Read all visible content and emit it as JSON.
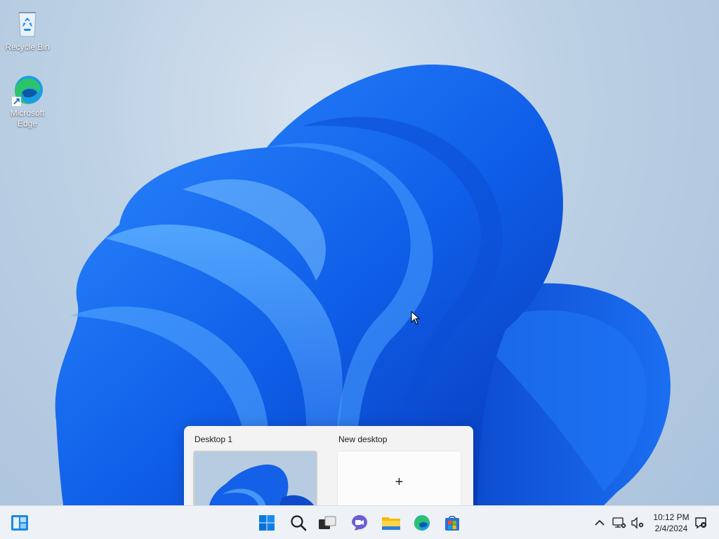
{
  "desktop": {
    "icons": [
      {
        "label": "Recycle Bin",
        "icon": "recycle-bin-icon"
      },
      {
        "label": "Microsoft Edge",
        "icon": "edge-icon"
      }
    ]
  },
  "task_view": {
    "desktops": [
      {
        "label": "Desktop 1"
      },
      {
        "label": "New desktop",
        "glyph": "+"
      }
    ]
  },
  "taskbar": {
    "left": {
      "icon": "widgets-icon"
    },
    "center": [
      {
        "icon": "start-icon"
      },
      {
        "icon": "search-icon"
      },
      {
        "icon": "task-view-icon"
      },
      {
        "icon": "chat-icon"
      },
      {
        "icon": "file-explorer-icon"
      },
      {
        "icon": "edge-icon"
      },
      {
        "icon": "microsoft-store-icon"
      }
    ],
    "tray": [
      {
        "icon": "chevron-up-icon"
      },
      {
        "icon": "network-icon"
      },
      {
        "icon": "volume-muted-icon"
      },
      {
        "icon": "notification-icon"
      }
    ],
    "clock": {
      "time": "10:12 PM",
      "date": "2/4/2024"
    }
  },
  "colors": {
    "accent": "#0067c0",
    "bloom": "#1a6cf0",
    "taskbar": "#eef1f6"
  }
}
